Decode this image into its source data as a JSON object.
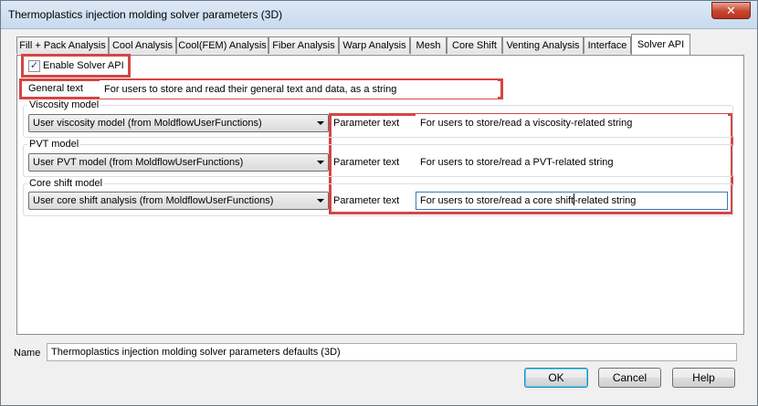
{
  "window": {
    "title": "Thermoplastics injection molding solver parameters (3D)",
    "close_glyph": "✕"
  },
  "tabs": [
    {
      "label": "Fill + Pack Analysis"
    },
    {
      "label": "Cool Analysis"
    },
    {
      "label": "Cool(FEM) Analysis"
    },
    {
      "label": "Fiber Analysis"
    },
    {
      "label": "Warp Analysis"
    },
    {
      "label": "Mesh"
    },
    {
      "label": "Core Shift"
    },
    {
      "label": "Venting Analysis"
    },
    {
      "label": "Interface"
    },
    {
      "label": "Solver API"
    }
  ],
  "solver_api": {
    "enable_label": "Enable Solver API",
    "enable_checked": true,
    "check_glyph": "✓",
    "general_text_label": "General text",
    "general_text_value": "For users to store and read their general text and data, as a string",
    "groups": [
      {
        "title": "Viscosity model",
        "selected": "User viscosity model (from MoldflowUserFunctions)",
        "param_label": "Parameter text",
        "param_value": "For users to store/read a viscosity-related string"
      },
      {
        "title": "PVT model",
        "selected": "User PVT model (from MoldflowUserFunctions)",
        "param_label": "Parameter text",
        "param_value": "For users to store/read a PVT-related string"
      },
      {
        "title": "Core shift model",
        "selected": "User core shift analysis (from MoldflowUserFunctions)",
        "param_label": "Parameter text",
        "param_value_before_caret": "For users to store/read a core shift",
        "param_value_after_caret": "-related string"
      }
    ]
  },
  "footer": {
    "name_label": "Name",
    "name_value": "Thermoplastics injection molding solver parameters defaults (3D)",
    "ok_label": "OK",
    "cancel_label": "Cancel",
    "help_label": "Help"
  },
  "colors": {
    "highlight_red": "#d64545",
    "default_button_border": "#3c7fb1"
  }
}
